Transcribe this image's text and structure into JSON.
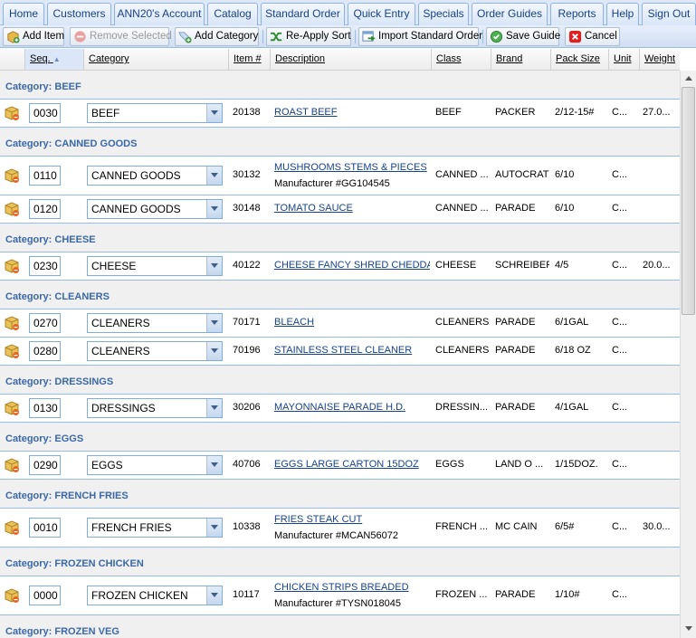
{
  "tabs": [
    "Home",
    "Customers",
    "ANN20's Account",
    "Catalog",
    "Standard Order",
    "Quick Entry",
    "Specials",
    "Order Guides",
    "Reports",
    "Help",
    "Sign Out"
  ],
  "toolbar": {
    "add_item": "Add Item",
    "remove_selected": "Remove Selected",
    "add_category": "Add Category",
    "reapply_sort": "Re-Apply Sort",
    "import_standard_order": "Import Standard Order",
    "save_guide": "Save Guide",
    "cancel": "Cancel"
  },
  "columns": {
    "seq": "Seq.",
    "category": "Category",
    "item": "Item #",
    "description": "Description",
    "class": "Class",
    "brand": "Brand",
    "pack_size": "Pack Size",
    "unit": "Unit",
    "weight": "Weight"
  },
  "sort": {
    "column": "seq",
    "direction": "ascending"
  },
  "colors": {
    "group_text": "#3a68a8",
    "link": "#15428b",
    "border": "#99bbe8"
  },
  "groups": [
    {
      "label": "Category: BEEF",
      "items": [
        {
          "seq": "0030",
          "category": "BEEF",
          "item": "20138",
          "description": "ROAST BEEF",
          "manufacturer": "",
          "class": "BEEF",
          "brand": "PACKER",
          "pack": "2/12-15#",
          "unit": "C...",
          "weight": "27.0..."
        }
      ]
    },
    {
      "label": "Category: CANNED GOODS",
      "items": [
        {
          "seq": "0110",
          "category": "CANNED GOODS",
          "item": "30132",
          "description": "MUSHROOMS STEMS & PIECES",
          "manufacturer": "Manufacturer #GG104545",
          "class": "CANNED ...",
          "brand": "AUTOCRAT",
          "pack": "6/10",
          "unit": "C...",
          "weight": ""
        },
        {
          "seq": "0120",
          "category": "CANNED GOODS",
          "item": "30148",
          "description": "TOMATO SAUCE",
          "manufacturer": "",
          "class": "CANNED ...",
          "brand": "PARADE",
          "pack": "6/10",
          "unit": "C...",
          "weight": ""
        }
      ]
    },
    {
      "label": "Category: CHEESE",
      "items": [
        {
          "seq": "0230",
          "category": "CHEESE",
          "item": "40122",
          "description": "CHEESE FANCY SHRED CHEDDAR",
          "manufacturer": "",
          "class": "CHEESE",
          "brand": "SCHREIBER",
          "pack": "4/5",
          "unit": "C...",
          "weight": "20.0..."
        }
      ]
    },
    {
      "label": "Category: CLEANERS",
      "items": [
        {
          "seq": "0270",
          "category": "CLEANERS",
          "item": "70171",
          "description": "BLEACH",
          "manufacturer": "",
          "class": "CLEANERS",
          "brand": "PARADE",
          "pack": "6/1GAL",
          "unit": "C...",
          "weight": ""
        },
        {
          "seq": "0280",
          "category": "CLEANERS",
          "item": "70196",
          "description": "STAINLESS STEEL CLEANER",
          "manufacturer": "",
          "class": "CLEANERS",
          "brand": "PARADE",
          "pack": "6/18 OZ",
          "unit": "C...",
          "weight": ""
        }
      ]
    },
    {
      "label": "Category: DRESSINGS",
      "items": [
        {
          "seq": "0130",
          "category": "DRESSINGS",
          "item": "30206",
          "description": "MAYONNAISE PARADE H.D.",
          "manufacturer": "",
          "class": "DRESSIN...",
          "brand": "PARADE",
          "pack": "4/1GAL",
          "unit": "C...",
          "weight": ""
        }
      ]
    },
    {
      "label": "Category: EGGS",
      "items": [
        {
          "seq": "0290",
          "category": "EGGS",
          "item": "40706",
          "description": "EGGS LARGE CARTON 15DOZ",
          "manufacturer": "",
          "class": "EGGS",
          "brand": "LAND O ...",
          "pack": "1/15DOZ.",
          "unit": "C...",
          "weight": ""
        }
      ]
    },
    {
      "label": "Category: FRENCH FRIES",
      "items": [
        {
          "seq": "0010",
          "category": "FRENCH FRIES",
          "item": "10338",
          "description": "FRIES STEAK CUT",
          "manufacturer": "Manufacturer #MCAN56072",
          "class": "FRENCH ...",
          "brand": "MC CAIN",
          "pack": "6/5#",
          "unit": "C...",
          "weight": "30.0..."
        }
      ]
    },
    {
      "label": "Category: FROZEN CHICKEN",
      "items": [
        {
          "seq": "0000",
          "category": "FROZEN CHICKEN",
          "item": "10117",
          "description": "CHICKEN STRIPS BREADED",
          "manufacturer": "Manufacturer #TYSN018045",
          "class": "FROZEN ...",
          "brand": "PARADE",
          "pack": "1/10#",
          "unit": "C...",
          "weight": ""
        }
      ]
    },
    {
      "label": "Category: FROZEN VEG",
      "items": []
    }
  ]
}
